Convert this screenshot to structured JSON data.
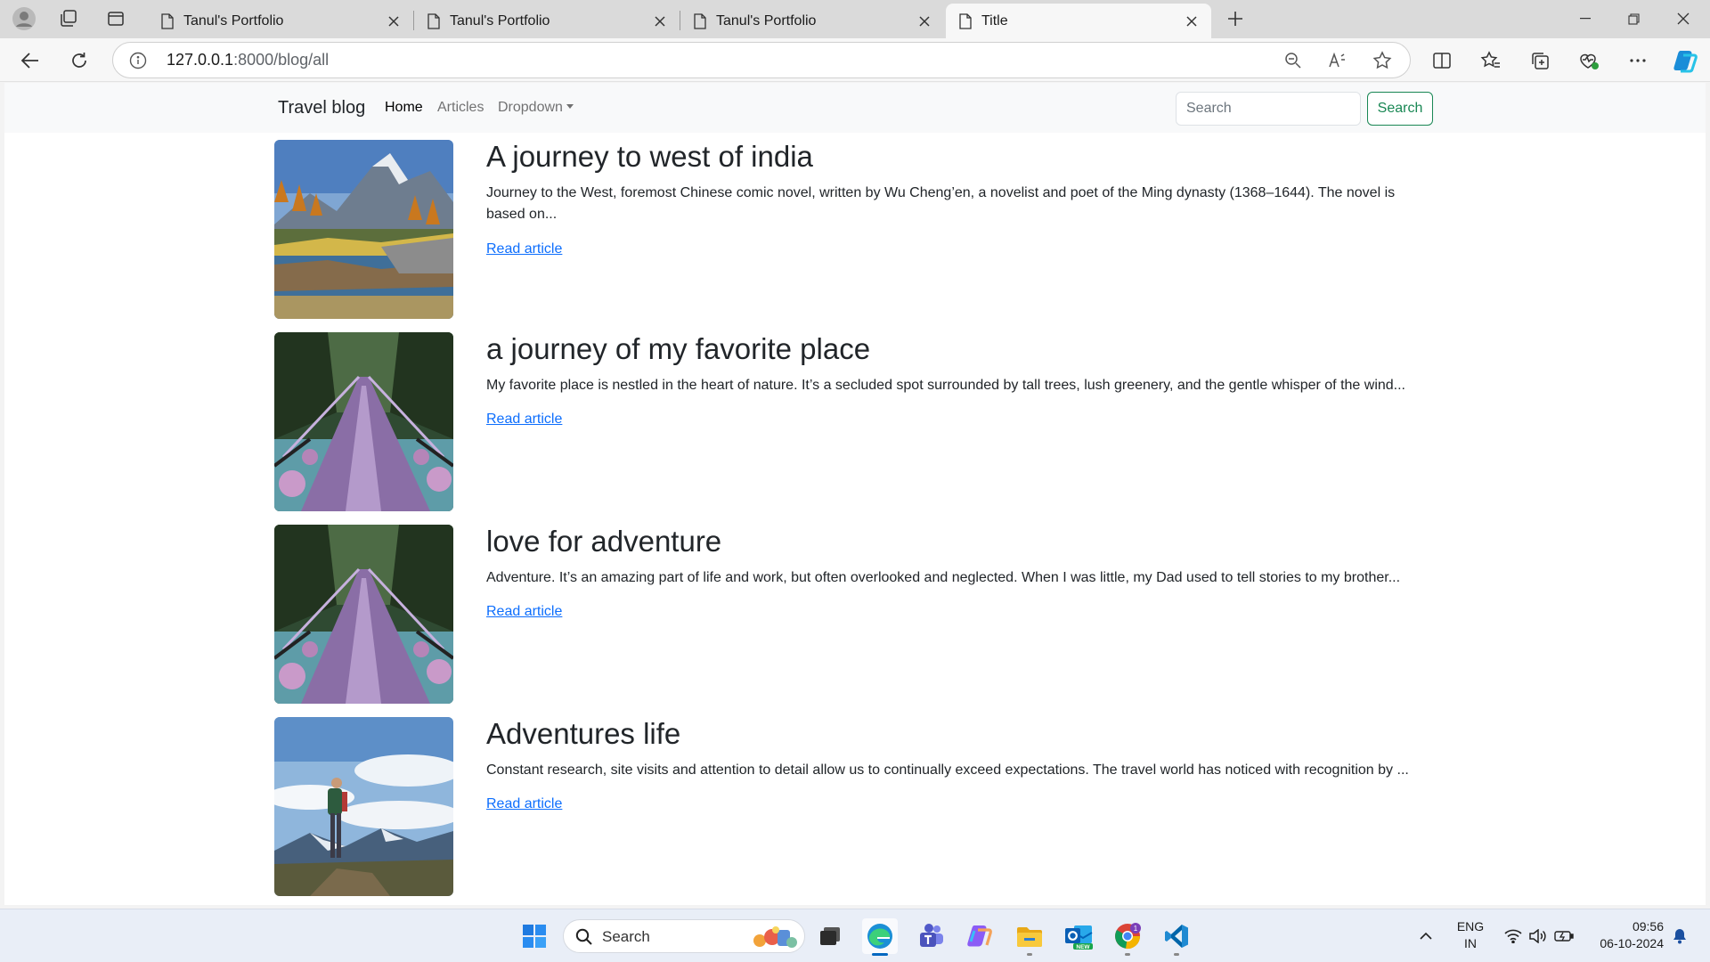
{
  "browser": {
    "tabs": [
      {
        "title": "Tanul's Portfolio",
        "active": false
      },
      {
        "title": "Tanul's Portfolio",
        "active": false
      },
      {
        "title": "Tanul's Portfolio",
        "active": false
      },
      {
        "title": "Title",
        "active": true
      }
    ],
    "address": {
      "host": "127.0.0.1",
      "path": ":8000/blog/all"
    }
  },
  "site": {
    "brand": "Travel blog",
    "nav": {
      "home": "Home",
      "articles": "Articles",
      "dropdown": "Dropdown"
    },
    "search": {
      "placeholder": "Search",
      "button": "Search"
    }
  },
  "articles": [
    {
      "title": "A journey to west of india",
      "excerpt": "Journey to the West, foremost Chinese comic novel, written by Wu Cheng’en, a novelist and poet of the Ming dynasty (1368–1644). The novel is based on...",
      "link": "Read article",
      "image": "mountain-lake-autumn"
    },
    {
      "title": "a journey of my favorite place",
      "excerpt": "My favorite place is nestled in the heart of nature. It’s a secluded spot surrounded by tall trees, lush greenery, and the gentle whisper of the wind...",
      "link": "Read article",
      "image": "forest-suspension-bridge"
    },
    {
      "title": "love for adventure",
      "excerpt": "Adventure. It’s an amazing part of life and work, but often overlooked and neglected. When I was little, my Dad used to tell stories to my brother...",
      "link": "Read article",
      "image": "forest-suspension-bridge"
    },
    {
      "title": "Adventures life",
      "excerpt": "Constant research, site visits and attention to detail allow us to continually exceed expectations. The travel world has noticed with recognition by ...",
      "link": "Read article",
      "image": "hiker-mountain-top"
    }
  ],
  "taskbar": {
    "search_label": "Search",
    "chrome_badge": "1",
    "outlook_badge": "NEW",
    "lang_top": "ENG",
    "lang_bottom": "IN",
    "time": "09:56",
    "date": "06-10-2024"
  },
  "colors": {
    "accent": "#0d6efd",
    "search_button": "#198754",
    "taskbar": "#e9eef7"
  }
}
